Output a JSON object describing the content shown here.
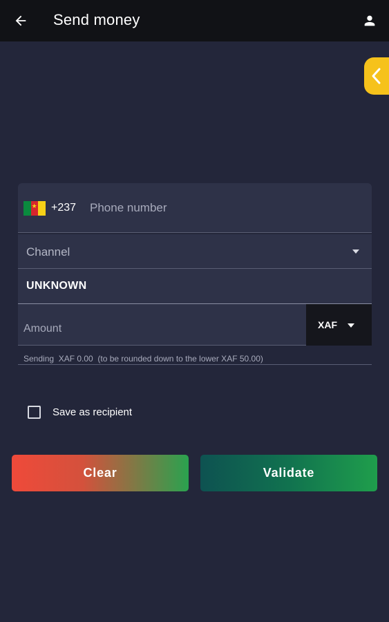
{
  "header": {
    "title": "Send money",
    "back_icon": "arrow-left-icon",
    "profile_icon": "person-icon"
  },
  "side_tab": {
    "icon": "chevron-left-icon",
    "color": "#f6c21b"
  },
  "form": {
    "phone": {
      "flag": "cameroon-flag-icon",
      "dial_code": "+237",
      "placeholder": "Phone number",
      "value": ""
    },
    "channel": {
      "label": "Channel",
      "icon": "dropdown-arrow-icon"
    },
    "channel_value": "UNKNOWN",
    "amount": {
      "placeholder": "Amount",
      "value": "",
      "currency": "XAF"
    },
    "hint": "Sending  XAF 0.00  (to be rounded down to the lower XAF 50.00)"
  },
  "save_recipient": {
    "label": "Save as recipient",
    "checked": false
  },
  "buttons": {
    "clear_label": "Clear",
    "validate_label": "Validate"
  },
  "colors": {
    "background": "#23263a",
    "appbar": "#111216",
    "accent": "#f6c21b"
  }
}
